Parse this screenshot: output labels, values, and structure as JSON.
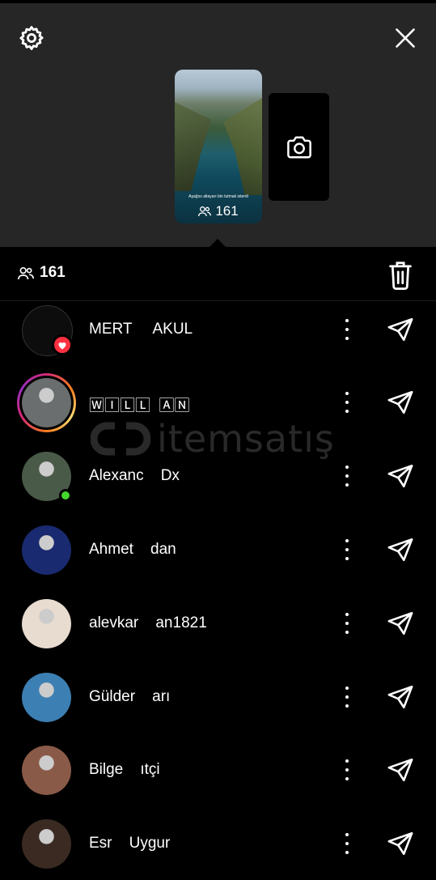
{
  "top": {
    "settings_icon": "gear-icon",
    "close_icon": "close-icon",
    "story": {
      "caption": "Aşağısı altayarı bin tutmak isterdi",
      "viewer_count": "161"
    },
    "camera_icon": "camera-icon"
  },
  "viewers": {
    "count": "161",
    "delete_icon": "trash-icon",
    "list": [
      {
        "name": "MERT     AKUL",
        "avatar_color": "#0d0d0d",
        "badge": "heart"
      },
      {
        "name": "🅆🄸🄻🄻  🄰🄽",
        "avatar_color": "#6b6e6e",
        "badge": "story-ring"
      },
      {
        "name": "Alexanc    Dx",
        "avatar_color": "#4a5a48",
        "badge": "online"
      },
      {
        "name": "Ahmet    dan",
        "avatar_color": "#1a2a70",
        "badge": ""
      },
      {
        "name": "alevkar    an1821",
        "avatar_color": "#e8dcd0",
        "badge": ""
      },
      {
        "name": "Gülder    arı",
        "avatar_color": "#3c7fb3",
        "badge": ""
      },
      {
        "name": "Bilge    ıtçi",
        "avatar_color": "#8a5a48",
        "badge": ""
      },
      {
        "name": "Esr    Uygur",
        "avatar_color": "#3a2a22",
        "badge": ""
      }
    ]
  },
  "watermark": "itemsatış"
}
